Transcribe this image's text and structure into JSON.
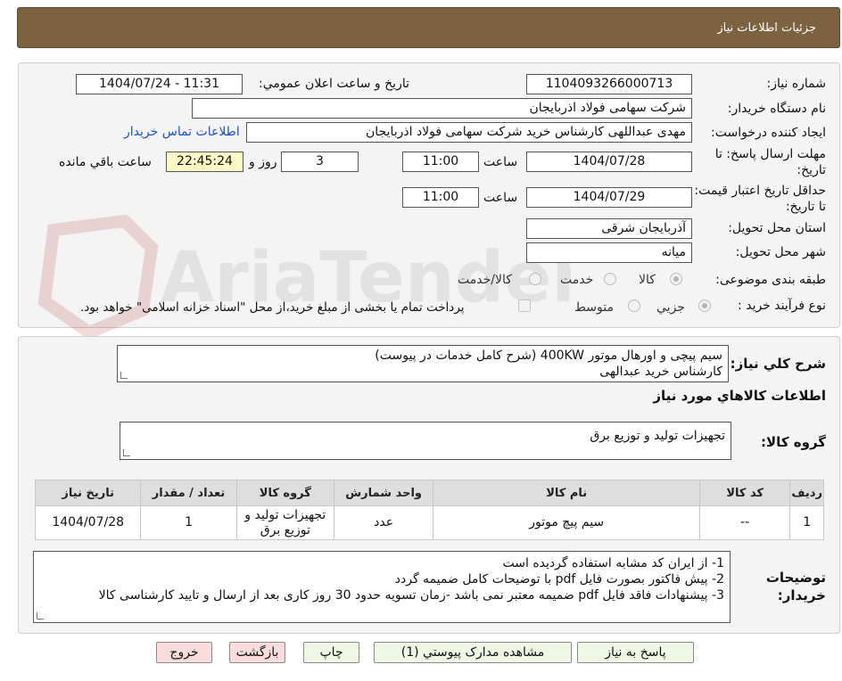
{
  "header": {
    "title": "جزئیات اطلاعات نیاز"
  },
  "watermark": {
    "brand": "AriaTender.neT"
  },
  "form": {
    "need_number_label": "شماره نیاز:",
    "need_number": "1104093266000713",
    "announce_label": "تاریخ و ساعت اعلان عمومي:",
    "announce_value": "1404/07/24 - 11:31",
    "buyer_org_label": "نام دستگاه خريدار:",
    "buyer_org": "شرکت سهامی فولاد اذربایجان",
    "requester_label": "ايجاد کننده درخواست:",
    "requester": "مهدی عبداللهی کارشناس خرید شرکت سهامی فولاد اذربایجان",
    "contact_link": "اطلاعات تماس خريدار",
    "deadline_label": "مهلت ارسال پاسخ: تا تاریخ:",
    "deadline_date": "1404/07/28",
    "time_label": "ساعت",
    "deadline_time": "11:00",
    "days_value": "3",
    "days_label": "روز و",
    "remaining_value": "22:45:24",
    "remaining_label": "ساعت باقي مانده",
    "validity_label": "حداقل تاريخ اعتبار قيمت: تا تاريخ:",
    "validity_date": "1404/07/29",
    "validity_time": "11:00",
    "province_label": "استان محل تحويل:",
    "province": "آذربايجان شرقی",
    "city_label": "شهر محل تحويل:",
    "city": "میانه",
    "category_label": "طبقه بندی موضوعی:",
    "category_options": [
      "کالا",
      "خدمت",
      "کالا/خدمت"
    ],
    "process_label": "نوع فرآيند خريد :",
    "process_options": [
      "جزيي",
      "متوسط"
    ],
    "payment_note": "پرداخت تمام یا بخشی از مبلغ خرید،از محل \"اسناد خزانه اسلامی\" خواهد بود."
  },
  "summary": {
    "label": "شرح كلي نياز:",
    "line1": "سیم پیچی و اورهال موتور 400KW (شرح کامل خدمات در پیوست)",
    "line2": "کارشناس خرید عبدالهی"
  },
  "goods": {
    "section_title": "اطلاعات كالاهاي مورد نياز",
    "group_label": "گروه كالا:",
    "group_value": "تجهیزات تولید و توزیع برق"
  },
  "table": {
    "headers": [
      "رديف",
      "کد کالا",
      "نام کالا",
      "واحد شمارش",
      "گروه کالا",
      "تعداد / مقدار",
      "تاریخ نیاز"
    ],
    "rows": [
      [
        "1",
        "--",
        "سیم پیچ موتور",
        "عدد",
        "تجهیزات تولید و توزیع برق",
        "1",
        "1404/07/28"
      ]
    ]
  },
  "notes": {
    "label": "توضيحات خريدار:",
    "line1": "1- از ایران کد مشابه استفاده گردیده است",
    "line2": "2- پیش فاکتور بصورت فایل pdf با توضیحات کامل ضمیمه گردد",
    "line3": "3- پیشنهادات فاقد فایل pdf  ضمیمه معتبر نمی باشد -زمان تسویه حدود 30  روز کاری بعد از ارسال و تایید کارشناسی کالا"
  },
  "buttons": {
    "reply": "پاسخ به نياز",
    "attachments": "مشاهده مدارک پيوستي (1)",
    "print": "چاپ",
    "back": "بازگشت",
    "exit": "خروج"
  },
  "colors": {
    "header_bg": "#7d6241",
    "link": "#1a4fcf",
    "button_green": "#eef8e4",
    "button_pink": "#fbdcdc"
  }
}
